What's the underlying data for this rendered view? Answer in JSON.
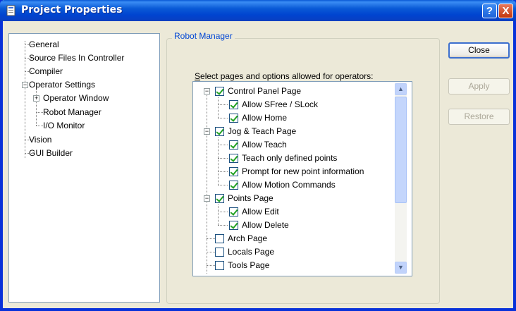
{
  "window": {
    "title": "Project Properties",
    "help_symbol": "?",
    "close_symbol": "X"
  },
  "nav": {
    "items": [
      {
        "label": "General"
      },
      {
        "label": "Source Files In Controller"
      },
      {
        "label": "Compiler"
      },
      {
        "label": "Operator Settings"
      },
      {
        "label": "Operator Window"
      },
      {
        "label": "Robot Manager"
      },
      {
        "label": "I/O Monitor"
      },
      {
        "label": "Vision"
      },
      {
        "label": "GUI Builder"
      }
    ]
  },
  "panel": {
    "group_title": "Robot Manager",
    "prompt_prefix": "S",
    "prompt_rest": "elect pages and options allowed for operators:",
    "options": [
      {
        "label": "Control Panel Page",
        "checked": true
      },
      {
        "label": "Allow SFree / SLock",
        "checked": true
      },
      {
        "label": "Allow Home",
        "checked": true
      },
      {
        "label": "Jog & Teach Page",
        "checked": true
      },
      {
        "label": "Allow Teach",
        "checked": true
      },
      {
        "label": "Teach only defined points",
        "checked": true
      },
      {
        "label": "Prompt for new point information",
        "checked": true
      },
      {
        "label": "Allow Motion Commands",
        "checked": true
      },
      {
        "label": "Points Page",
        "checked": true
      },
      {
        "label": "Allow Edit",
        "checked": true
      },
      {
        "label": "Allow Delete",
        "checked": true
      },
      {
        "label": "Arch Page",
        "checked": false
      },
      {
        "label": "Locals Page",
        "checked": false
      },
      {
        "label": "Tools Page",
        "checked": false
      }
    ]
  },
  "buttons": {
    "close": "Close",
    "apply": "Apply",
    "restore": "Restore"
  },
  "colors": {
    "titlebar": "#0a5ad6",
    "check": "#21a121",
    "group_title": "#0046d5"
  }
}
